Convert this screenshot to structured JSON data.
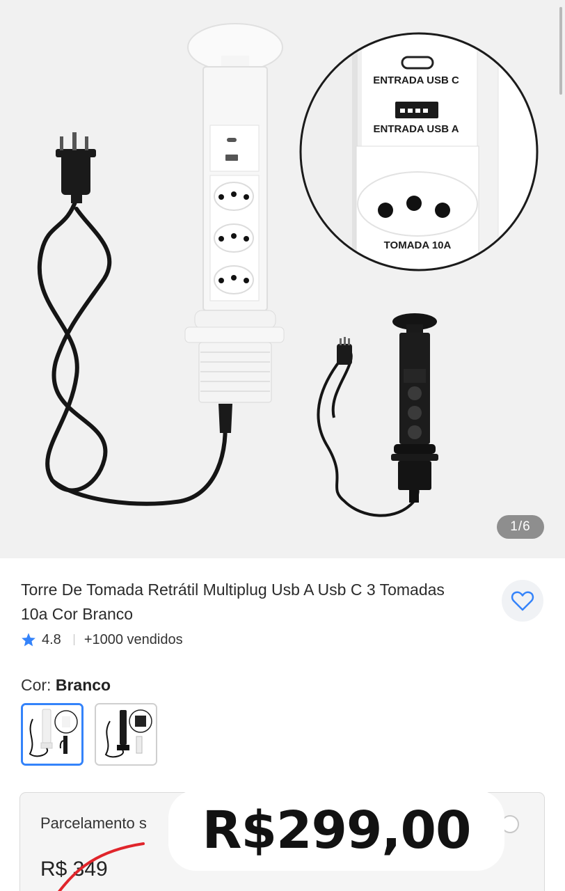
{
  "gallery": {
    "pager": "1/6",
    "callout": {
      "usb_c_label": "ENTRADA USB C",
      "usb_a_label": "ENTRADA USB A",
      "outlet_label": "TOMADA 10A"
    }
  },
  "product": {
    "title": "Torre De Tomada Retrátil Multiplug Usb A Usb C 3 Tomadas 10a Cor Branco",
    "rating": "4.8",
    "sold": "+1000 vendidos"
  },
  "variant": {
    "label": "Cor:",
    "selected": "Branco",
    "options": [
      "Branco",
      "Preto"
    ]
  },
  "price": {
    "installment_label": "Parcelamento s",
    "old_price": "R$ 349",
    "promo_price": "R$299,00"
  },
  "icons": {
    "favorite": "heart-icon",
    "rating": "star-icon"
  },
  "colors": {
    "accent": "#3483fa",
    "strike": "#e0252b"
  }
}
